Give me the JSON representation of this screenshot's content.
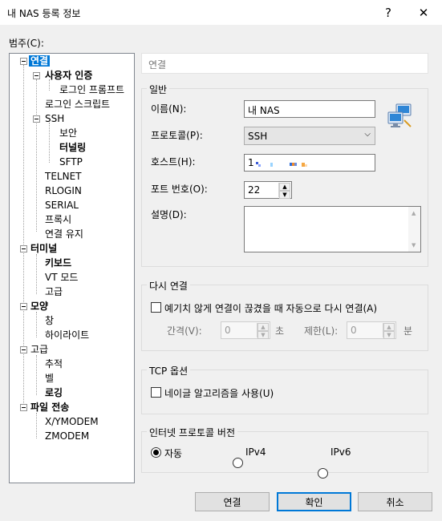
{
  "window": {
    "title": "내 NAS 등록 정보",
    "help": "?",
    "close": "✕"
  },
  "tree": {
    "label": "범주(C):",
    "items": [
      {
        "label": "연결"
      },
      {
        "label": "사용자 인증"
      },
      {
        "label": "로그인 프롬프트"
      },
      {
        "label": "로그인 스크립트"
      },
      {
        "label": "SSH"
      },
      {
        "label": "보안"
      },
      {
        "label": "터널링"
      },
      {
        "label": "SFTP"
      },
      {
        "label": "TELNET"
      },
      {
        "label": "RLOGIN"
      },
      {
        "label": "SERIAL"
      },
      {
        "label": "프록시"
      },
      {
        "label": "연결 유지"
      },
      {
        "label": "터미널"
      },
      {
        "label": "키보드"
      },
      {
        "label": "VT 모드"
      },
      {
        "label": "고급"
      },
      {
        "label": "모양"
      },
      {
        "label": "창"
      },
      {
        "label": "하이라이트"
      },
      {
        "label": "고급"
      },
      {
        "label": "추적"
      },
      {
        "label": "벨"
      },
      {
        "label": "로깅"
      },
      {
        "label": "파일 전송"
      },
      {
        "label": "X/YMODEM"
      },
      {
        "label": "ZMODEM"
      }
    ]
  },
  "panel": {
    "header": "연결",
    "general": {
      "title": "일반",
      "name_label": "이름(N):",
      "name_value": "내 NAS",
      "protocol_label": "프로토콜(P):",
      "protocol_value": "SSH",
      "host_label": "호스트(H):",
      "host_value": "1",
      "port_label": "포트 번호(O):",
      "port_value": "22",
      "desc_label": "설명(D):",
      "desc_value": ""
    },
    "reconnect": {
      "title": "다시 연결",
      "checkbox_label": "예기치 않게 연결이 끊겼을 때 자동으로 다시 연결(A)",
      "interval_label": "간격(V):",
      "interval_value": "0",
      "interval_unit": "초",
      "limit_label": "제한(L):",
      "limit_value": "0",
      "limit_unit": "분"
    },
    "tcp": {
      "title": "TCP 옵션",
      "checkbox_label": "네이글 알고리즘을 사용(U)"
    },
    "ipver": {
      "title": "인터넷 프로토콜 버전",
      "options": [
        "자동",
        "IPv4",
        "IPv6"
      ],
      "selected": "자동"
    }
  },
  "buttons": {
    "connect": "연결",
    "ok": "확인",
    "cancel": "취소"
  }
}
